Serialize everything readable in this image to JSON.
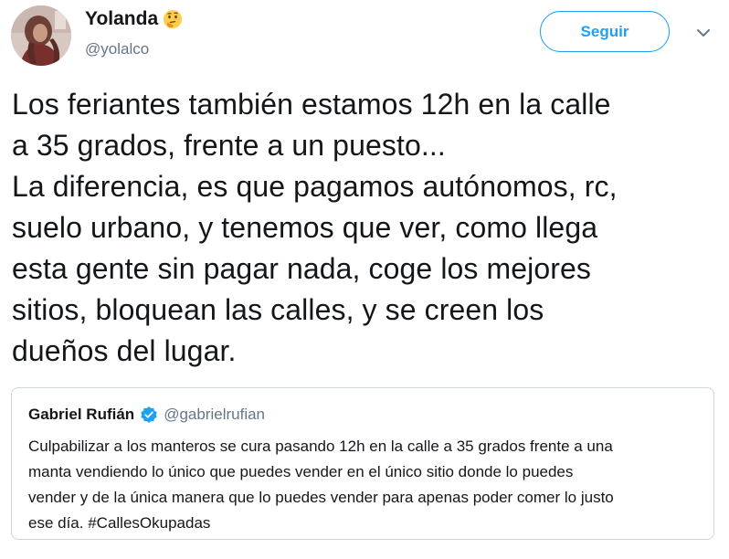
{
  "author": {
    "name": "Yolanda",
    "emoji": "thinking-face-icon",
    "handle": "@yolalco"
  },
  "actions": {
    "follow_label": "Seguir",
    "more_icon": "chevron-down-icon"
  },
  "tweet": {
    "lines": [
      "Los feriantes también estamos 12h en la calle",
      "a 35 grados, frente a un puesto...",
      "La diferencia, es que pagamos autónomos, rc,",
      "suelo urbano, y tenemos que ver, como llega",
      "esta gente sin pagar nada, coge los mejores",
      "sitios, bloquean las calles, y se creen los",
      "dueños del lugar."
    ]
  },
  "quoted_tweet": {
    "name": "Gabriel Rufián",
    "verified_icon": "verified-badge-icon",
    "handle": "@gabrielrufian",
    "lines": [
      "Culpabilizar a los manteros se cura pasando 12h en la calle a 35 grados frente a una",
      "manta vendiendo lo único que puedes vender en el único sitio donde lo puedes",
      "vender y de la única manera que lo puedes vender para apenas poder comer lo justo",
      "ese día. #CallesOkupadas"
    ]
  },
  "colors": {
    "accent": "#1da1f2",
    "text": "#14171a",
    "secondary_text": "#657786",
    "border": "#ccd6dd"
  }
}
